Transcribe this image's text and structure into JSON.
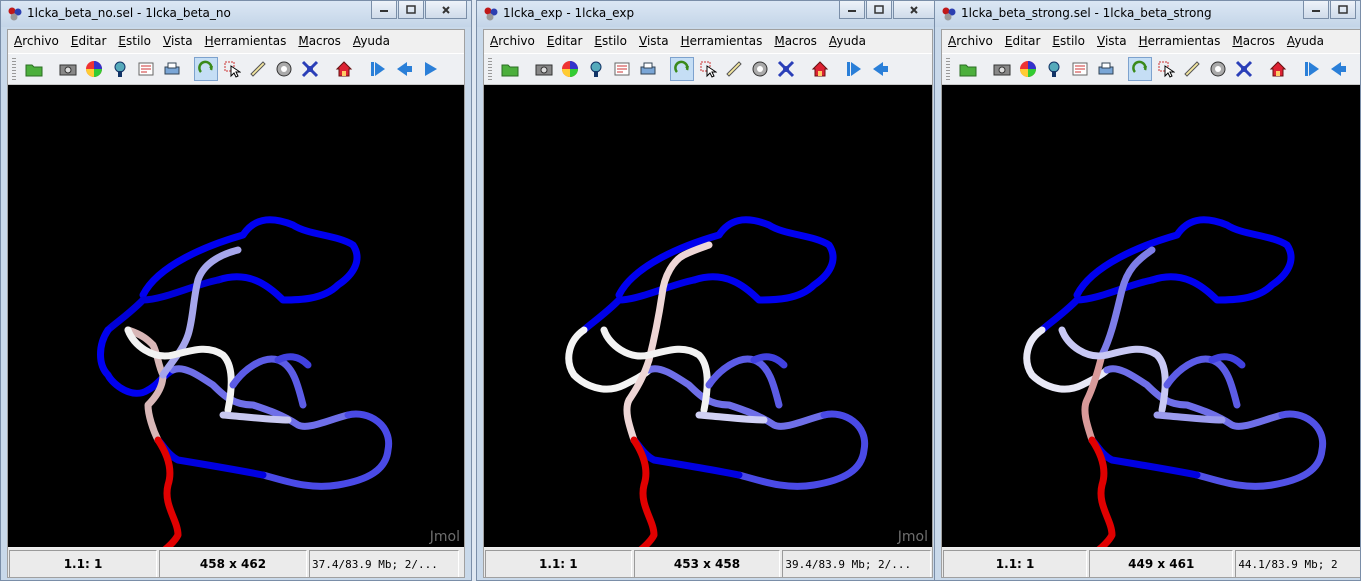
{
  "menu": [
    "Archivo",
    "Editar",
    "Estilo",
    "Vista",
    "Herramientas",
    "Macros",
    "Ayuda"
  ],
  "colors": {
    "high": "#e00000",
    "low": "#0000f0",
    "mid": "#f4f4f4",
    "background": "#000000"
  },
  "windows": [
    {
      "title": "1lcka_beta_no.sel - 1lcka_beta_no",
      "status": {
        "frame": "1.1: 1",
        "size": "458 x 462",
        "memory": "37.4/83.9 Mb;  2/..."
      },
      "logo": "Jmol"
    },
    {
      "title": "1lcka_exp - 1lcka_exp",
      "status": {
        "frame": "1.1: 1",
        "size": "453 x 458",
        "memory": "39.4/83.9 Mb;  2/..."
      },
      "logo": "Jmol"
    },
    {
      "title": "1lcka_beta_strong.sel - 1lcka_beta_strong",
      "status": {
        "frame": "1.1: 1",
        "size": "449 x 461",
        "memory": "44.1/83.9 Mb;  2"
      },
      "logo": ""
    }
  ]
}
